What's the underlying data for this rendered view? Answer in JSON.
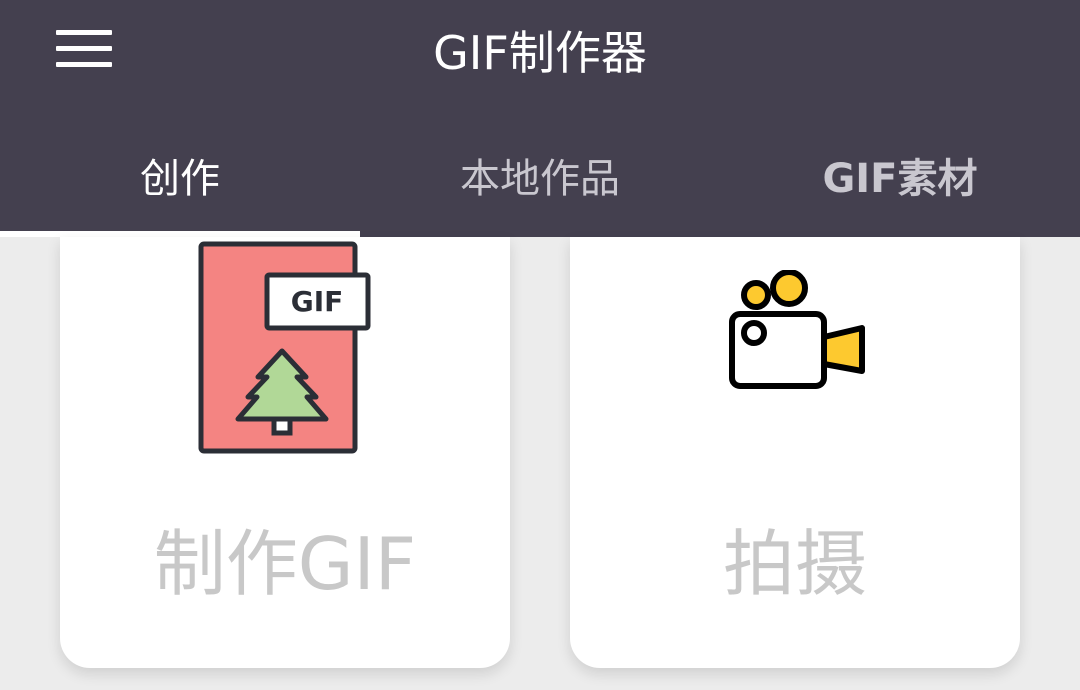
{
  "appbar": {
    "menu_icon": "hamburger-menu-icon",
    "title": "GIF制作器"
  },
  "tabs": [
    {
      "label": "创作",
      "selected": true
    },
    {
      "label": "本地作品",
      "selected": false
    },
    {
      "label": "GIF素材",
      "selected": false
    }
  ],
  "cards": [
    {
      "label": "制作GIF",
      "icon": "gif-file-icon",
      "icon_text": "GIF"
    },
    {
      "label": "拍摄",
      "icon": "video-camera-icon"
    }
  ],
  "colors": {
    "appbar": "#44404f",
    "background": "#ececec",
    "card": "#ffffff",
    "label_text": "#c8c8c8",
    "gif_file": "#f48482",
    "tree": "#b1d897",
    "camera_accent": "#fdc92f",
    "outline": "#2b2e36"
  }
}
